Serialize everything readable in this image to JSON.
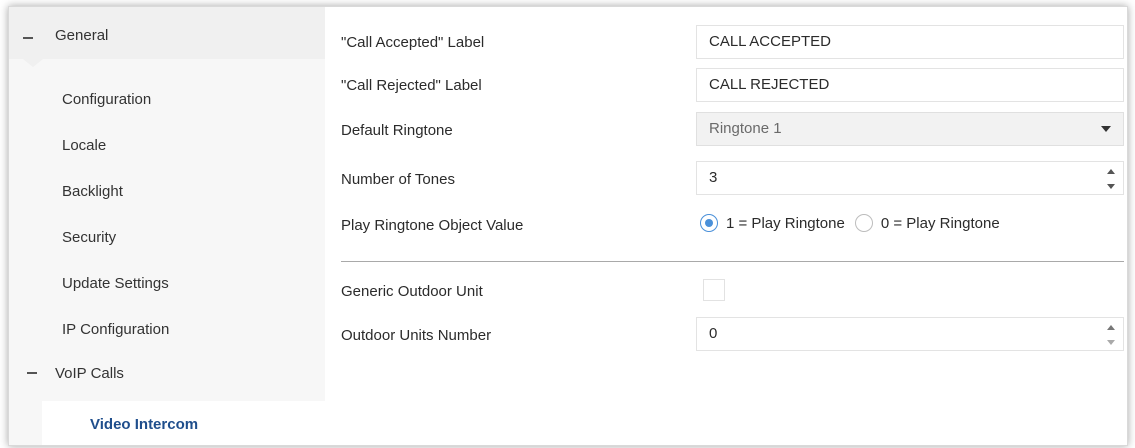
{
  "sidebar": {
    "general": {
      "label": "General"
    },
    "items": [
      {
        "label": "Configuration"
      },
      {
        "label": "Locale"
      },
      {
        "label": "Backlight"
      },
      {
        "label": "Security"
      },
      {
        "label": "Update Settings"
      },
      {
        "label": "IP Configuration"
      }
    ],
    "voip": {
      "label": "VoIP Calls"
    },
    "active_item": {
      "label": "Video Intercom"
    }
  },
  "form": {
    "call_accepted": {
      "label": "\"Call Accepted\" Label",
      "value": "CALL ACCEPTED"
    },
    "call_rejected": {
      "label": "\"Call Rejected\" Label",
      "value": "CALL REJECTED"
    },
    "default_ringtone": {
      "label": "Default Ringtone",
      "value": "Ringtone 1"
    },
    "number_of_tones": {
      "label": "Number of Tones",
      "value": "3"
    },
    "play_ringtone": {
      "label": "Play Ringtone Object Value",
      "options": [
        "1 = Play Ringtone",
        "0 = Play Ringtone"
      ],
      "selected": "1 = Play Ringtone"
    },
    "generic_outdoor_unit": {
      "label": "Generic Outdoor Unit",
      "checked": false
    },
    "outdoor_units_number": {
      "label": "Outdoor Units Number",
      "value": "0"
    }
  },
  "colors": {
    "active_text": "#1f4e8c",
    "radio_accent": "#4a90d9",
    "sidebar_bg": "#f0f0f0"
  }
}
